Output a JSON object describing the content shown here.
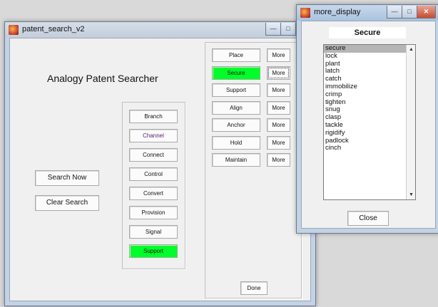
{
  "main_window": {
    "title": "patent_search_v2",
    "heading": "Analogy Patent Searcher",
    "search_now_label": "Search Now",
    "clear_search_label": "Clear Search",
    "categories": [
      "Branch",
      "Channel",
      "Connect",
      "Control",
      "Convert",
      "Provision",
      "Signal",
      "Support"
    ],
    "selected_category": "Support",
    "terms": [
      "Place",
      "Secure",
      "Support",
      "Align",
      "Anchor",
      "Hold",
      "Maintain"
    ],
    "selected_term": "Secure",
    "more_label": "More",
    "done_label": "Done"
  },
  "more_window": {
    "title": "more_display",
    "heading": "Secure",
    "synonyms": [
      "secure",
      "lock",
      "plant",
      "latch",
      "catch",
      "immobilize",
      "crimp",
      "tighten",
      "snug",
      "clasp",
      "tackle",
      "rigidify",
      "padlock",
      "cinch"
    ],
    "selected_synonym": "secure",
    "close_label": "Close"
  },
  "colors": {
    "selected_green": "#00ff2a",
    "window_bg": "#f0f0f0",
    "titlebar": "#aac3df",
    "close_button": "#c84a32"
  }
}
